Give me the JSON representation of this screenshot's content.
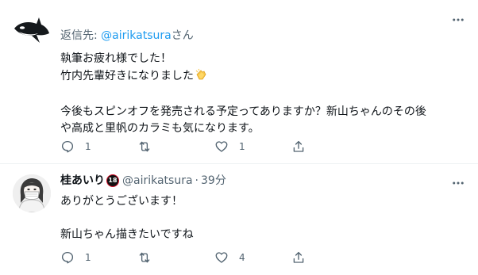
{
  "tweets": [
    {
      "reply_prefix": "返信先: ",
      "reply_mention": "@airikatsura",
      "reply_suffix": "さん",
      "lines": [
        "執筆お疲れ様でした！",
        "竹内先輩好きになりました",
        "",
        "今後もスピンオフを発売される予定ってありますか？新山ちゃんのその後",
        "や高成と里帆のカラミも気になります。"
      ],
      "emoji_icon": "clapping-hands-icon",
      "actions": {
        "reply_count": "1",
        "retweet_count": "",
        "like_count": "1",
        "share_count": ""
      }
    },
    {
      "name": "桂あいり",
      "badge": "18",
      "handle": "@airikatsura",
      "dot": "·",
      "time": "39分",
      "lines": [
        "ありがとうございます！",
        "",
        "新山ちゃん描きたいですね"
      ],
      "actions": {
        "reply_count": "1",
        "retweet_count": "",
        "like_count": "4",
        "share_count": ""
      }
    }
  ],
  "colors": {
    "text": "#0f1419",
    "secondary": "#536471",
    "link": "#1d9bf0",
    "divider": "#eff3f4"
  }
}
